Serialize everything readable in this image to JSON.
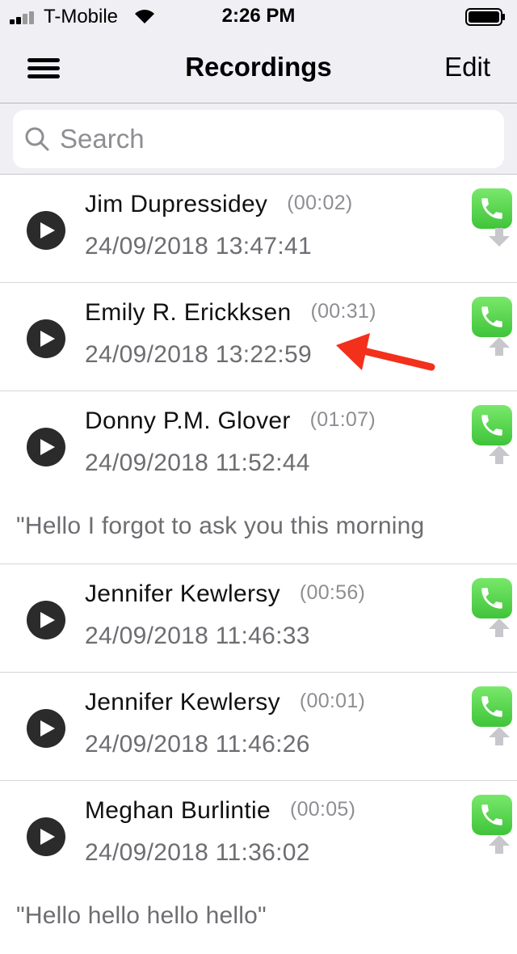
{
  "status": {
    "carrier": "T-Mobile",
    "time": "2:26 PM"
  },
  "nav": {
    "title": "Recordings",
    "edit_label": "Edit"
  },
  "search": {
    "placeholder": "Search"
  },
  "colors": {
    "call_green": "#4cd964",
    "annotation_red": "#f2301c",
    "separator": "#d6d6da"
  },
  "recordings": [
    {
      "name": "Jim Dupressidey",
      "duration": "(00:02)",
      "datetime": "24/09/2018 13:47:41",
      "direction_icon": "download-arrow-icon"
    },
    {
      "name": "Emily R. Erickksen",
      "duration": "(00:31)",
      "datetime": "24/09/2018 13:22:59",
      "direction_icon": "upload-arrow-icon"
    },
    {
      "name": "Donny P.M. Glover",
      "duration": "(01:07)",
      "datetime": "24/09/2018 11:52:44",
      "direction_icon": "upload-arrow-icon",
      "transcript": "\"Hello I forgot to ask you this morning"
    },
    {
      "name": "Jennifer Kewlersy",
      "duration": "(00:56)",
      "datetime": "24/09/2018 11:46:33",
      "direction_icon": "upload-arrow-icon"
    },
    {
      "name": "Jennifer Kewlersy",
      "duration": "(00:01)",
      "datetime": "24/09/2018 11:46:26",
      "direction_icon": "upload-arrow-icon"
    },
    {
      "name": "Meghan Burlintie",
      "duration": "(00:05)",
      "datetime": "24/09/2018 11:36:02",
      "direction_icon": "upload-arrow-icon",
      "transcript": "\"Hello hello hello hello\""
    }
  ]
}
